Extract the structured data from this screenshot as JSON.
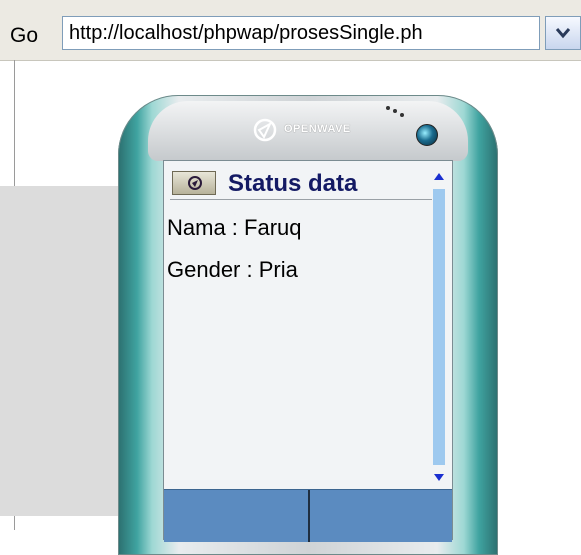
{
  "addressbar": {
    "go_label": "Go",
    "url": "http://localhost/phpwap/prosesSingle.ph",
    "dropdown_icon": "chevron-down-icon"
  },
  "phone": {
    "brand": "OPENWAVE",
    "screen": {
      "title": "Status data",
      "lines": [
        "Nama : Faruq",
        "Gender : Pria"
      ]
    },
    "colors": {
      "title_text": "#141a64",
      "scroll_track": "#9ec9ef",
      "softkey_bar": "#5b8bc0",
      "phone_teal": "#3fa3a0"
    }
  }
}
